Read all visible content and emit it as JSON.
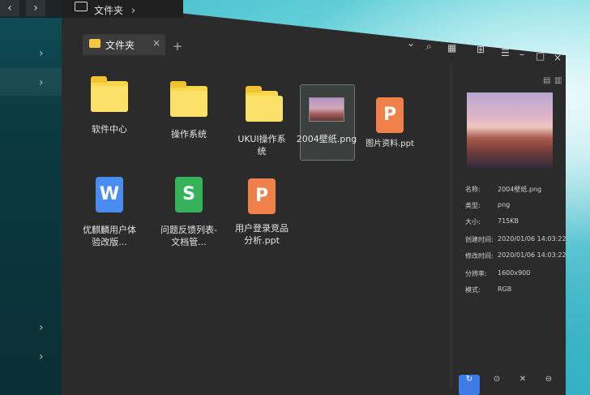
{
  "path": {
    "label": "文件夹"
  },
  "tab": {
    "label": "文件夹",
    "close": "×",
    "add": "+"
  },
  "toolbar": {
    "search_icon": "⌕",
    "view_icon": "▦",
    "grid_icon": "⊞",
    "menu_icon": "☰",
    "min_icon": "–",
    "max_icon": "□",
    "close_icon": "×"
  },
  "files": [
    {
      "name": "软件中心",
      "type": "folder"
    },
    {
      "name": "操作系统",
      "type": "folder"
    },
    {
      "name": "UKUI操作系\n统",
      "type": "folder"
    },
    {
      "name": "2004壁纸.png",
      "type": "image"
    },
    {
      "name": "图片资料.ppt",
      "type": "ppt"
    },
    {
      "name": "优麒麟用户体\n验改版...",
      "type": "wps"
    },
    {
      "name": "问题反馈列表-\n文档管...",
      "type": "et"
    },
    {
      "name": "用户登录竞品\n分析.ppt",
      "type": "ppt"
    }
  ],
  "details": {
    "name_label": "名称:",
    "name_value": "2004壁纸.png",
    "type_label": "类型:",
    "type_value": "png",
    "size_label": "大小:",
    "size_value": "715KB",
    "created_label": "创建时间:",
    "created_value": "2020/01/06 14:03:22",
    "modified_label": "修改时间:",
    "modified_value": "2020/01/06 14:03:22",
    "resolution_label": "分辨率:",
    "resolution_value": "1600x900",
    "mode_label": "模式:",
    "mode_value": "RGB"
  },
  "bottom": {
    "btn2": "⊙",
    "btn3": "✕",
    "btn4": "⊖"
  },
  "colors": {
    "accent": "#3e7be6",
    "folder": "#f9d84b"
  }
}
